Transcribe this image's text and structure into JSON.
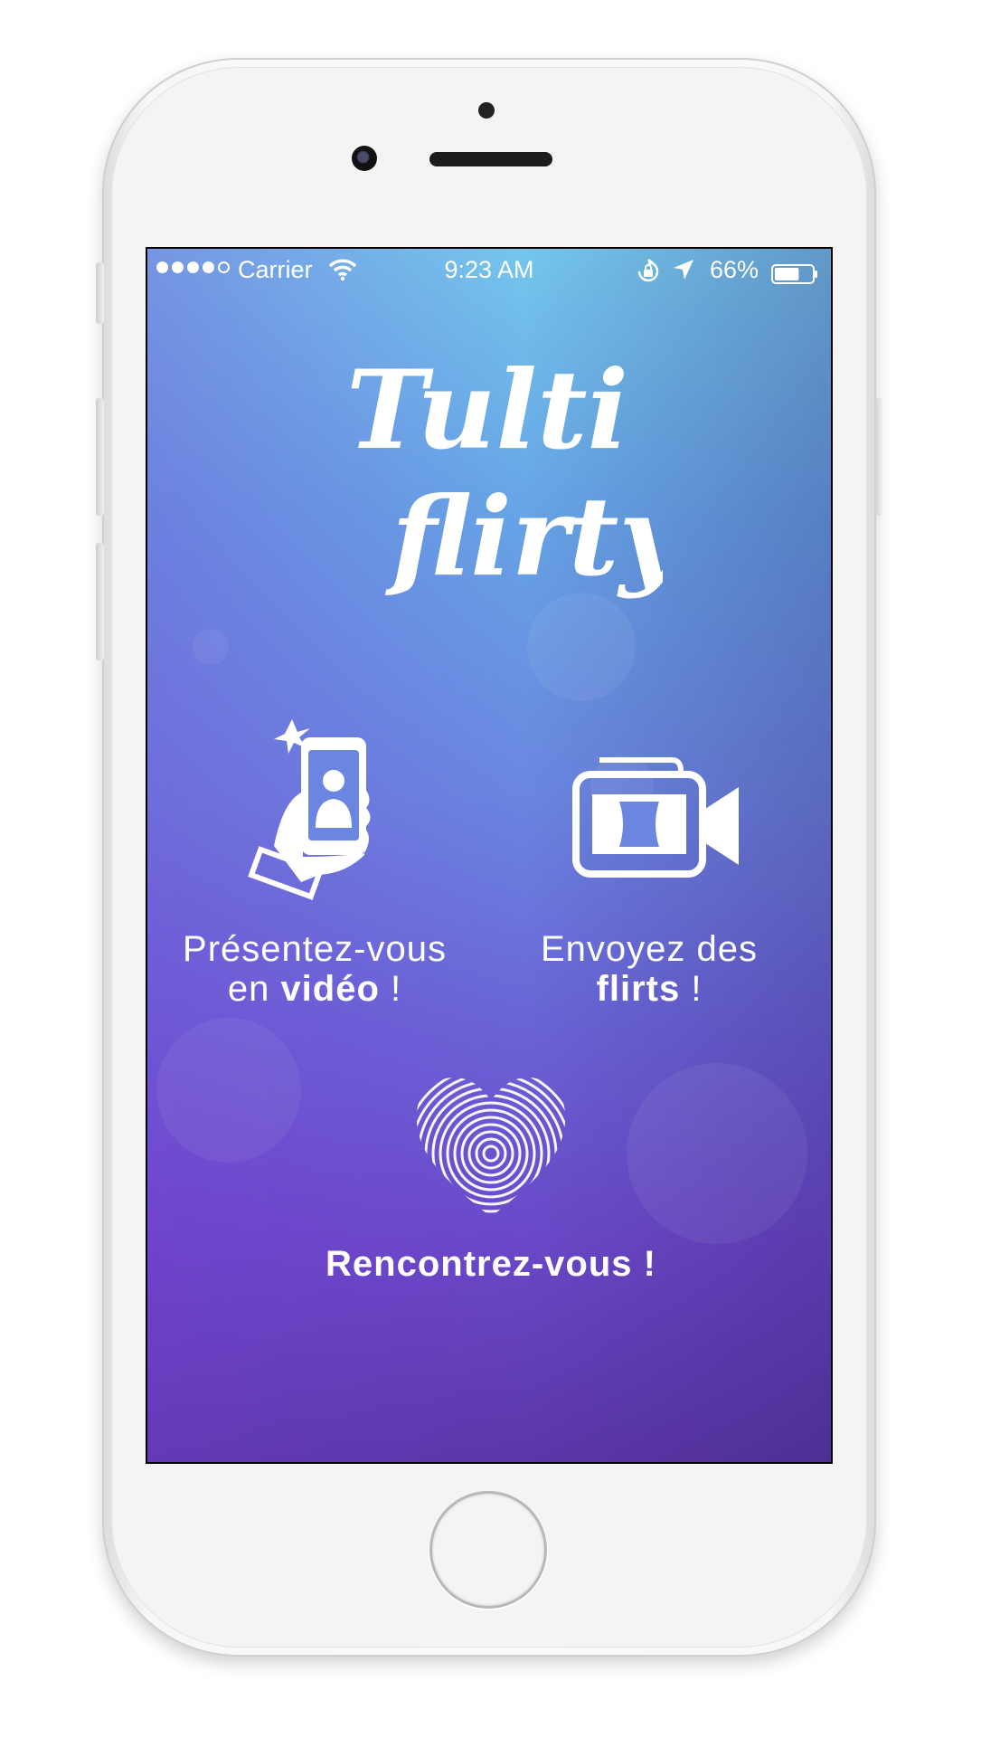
{
  "status_bar": {
    "carrier": "Carrier",
    "time": "9:23 AM",
    "battery_percent": "66%",
    "battery_level": 0.66,
    "signal_bars": 4,
    "signal_max": 5
  },
  "app": {
    "logo_line1": "Tulti",
    "logo_line2": "flirty"
  },
  "features": {
    "video": {
      "line1": "Présentez-vous",
      "line2_prefix": "en ",
      "line2_bold": "vidéo",
      "line2_suffix": " !"
    },
    "flirts": {
      "line1": "Envoyez des",
      "line2_bold": "flirts",
      "line2_suffix": " !"
    },
    "meet": {
      "label": "Rencontrez-vous !"
    }
  },
  "colors": {
    "gradient_top": "#74c6ec",
    "gradient_bottom": "#5a37a8",
    "text": "#ffffff"
  },
  "icons": {
    "selfie": "selfie-phone-hand-icon",
    "camera": "video-camera-icon",
    "fingerprint": "fingerprint-heart-icon"
  }
}
